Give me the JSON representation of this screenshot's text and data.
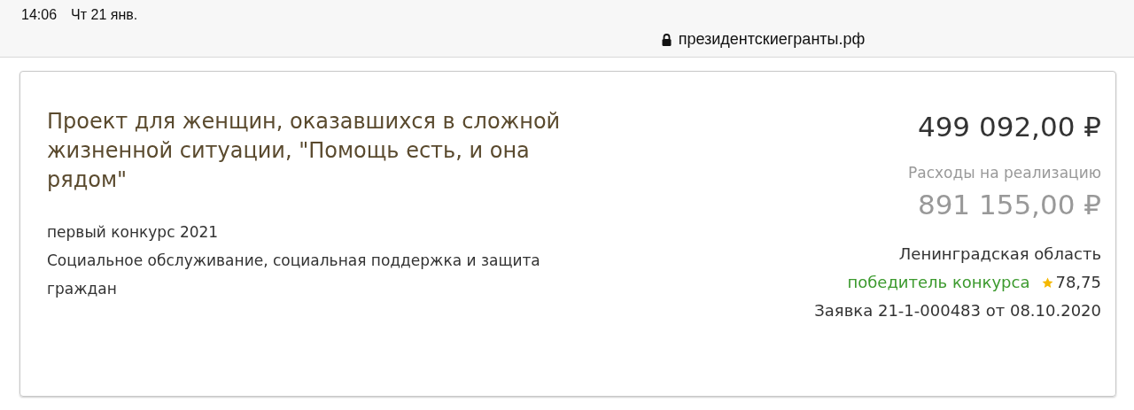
{
  "status_bar": {
    "time": "14:06",
    "date": "Чт 21 янв.",
    "url": "президентскиегранты.рф"
  },
  "project": {
    "title": "Проект для женщин, оказавшихся в сложной жизненной ситуации, \"Помощь есть, и она рядом\"",
    "contest": "первый конкурс 2021",
    "category": "Социальное обслуживание, социальная поддержка и защита граждан",
    "amount": "499 092,00 ₽",
    "expenses_label": "Расходы на реализацию",
    "expenses": "891 155,00 ₽",
    "region": "Ленинградская область",
    "status": "победитель конкурса",
    "rating": "78,75",
    "application": "Заявка 21-1-000483 от 08.10.2020"
  }
}
